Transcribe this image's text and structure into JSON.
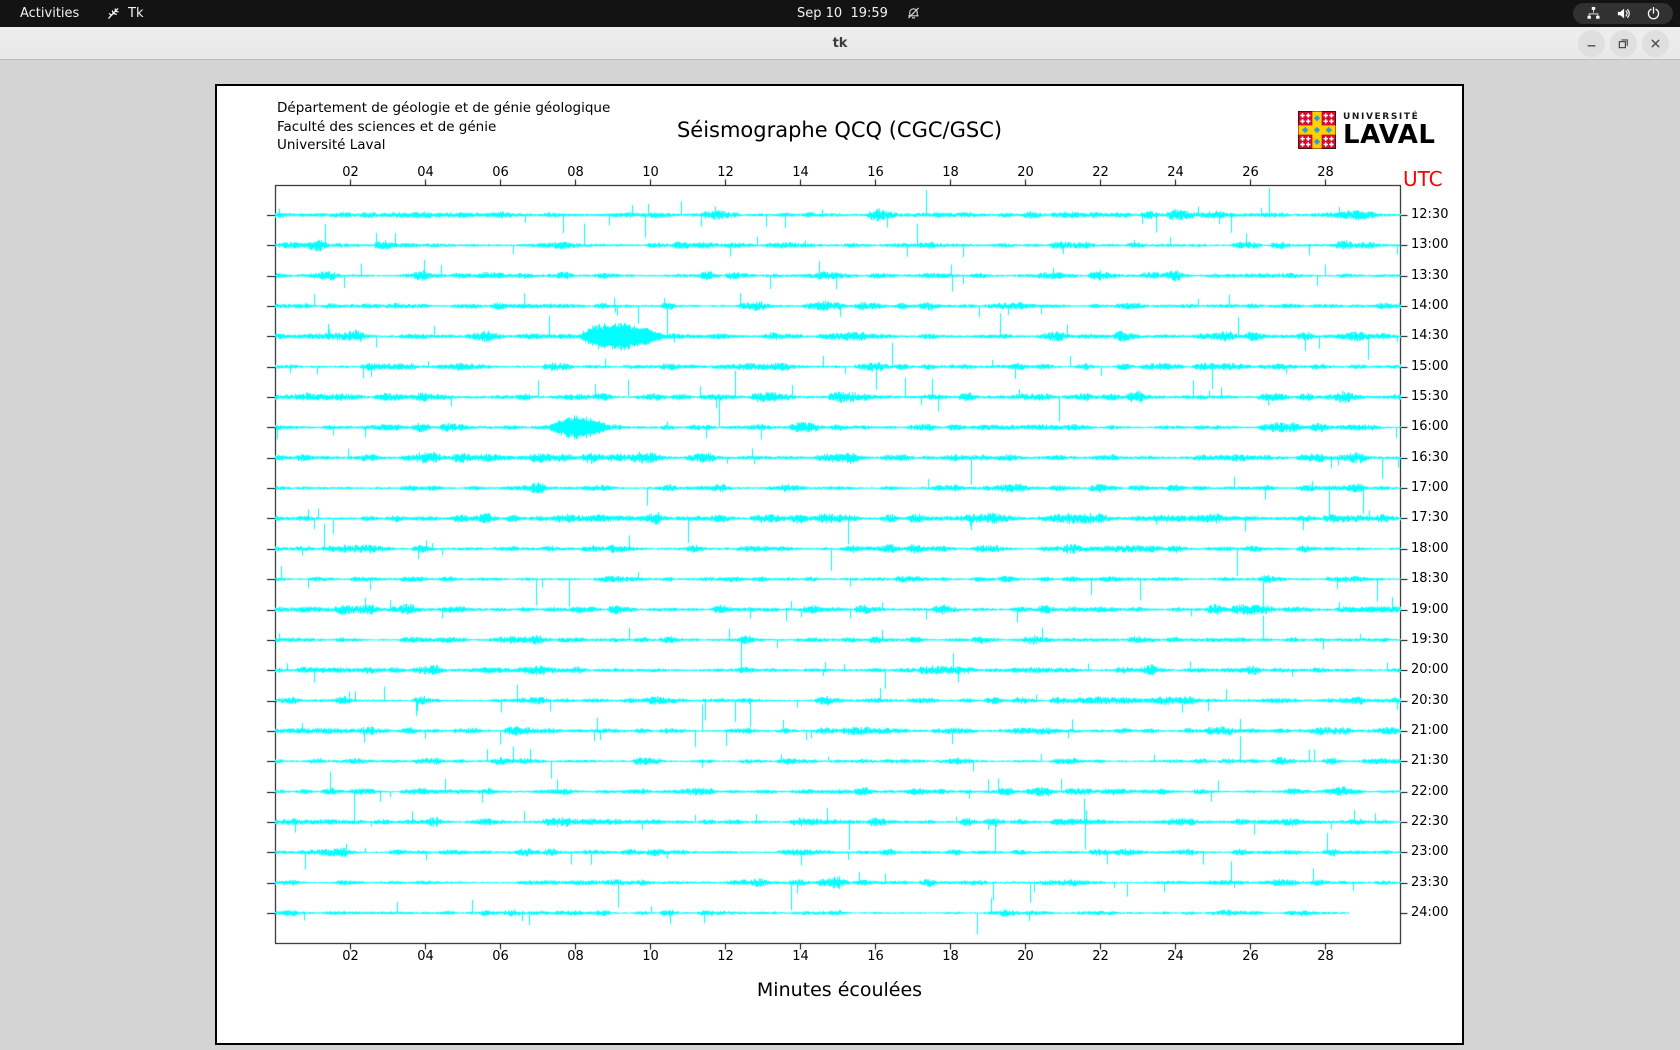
{
  "desktop": {
    "top_bar": {
      "activities_label": "Activities",
      "app_name": "Tk",
      "clock": "Sep 10  19:59"
    },
    "window": {
      "title": "tk"
    }
  },
  "plot": {
    "header_lines": [
      "Département de géologie et de génie géologique",
      "Faculté des sciences et de génie",
      "Université Laval"
    ],
    "logo_line1": "UNIVERSITÉ",
    "logo_line2": "LAVAL"
  },
  "chart_data": {
    "type": "seismogram-helicorder",
    "title": "Séismographe QCQ (CGC/GSC)",
    "xlabel": "Minutes écoulées",
    "right_axis_label": "UTC",
    "x_ticks": [
      "02",
      "04",
      "06",
      "08",
      "10",
      "12",
      "14",
      "16",
      "18",
      "20",
      "22",
      "24",
      "26",
      "28"
    ],
    "x_range_minutes": [
      0,
      30
    ],
    "trace_color": "#00ffff",
    "axis_color": "#000000",
    "utc_label_color": "#ff0000",
    "rows": [
      {
        "label": "12:30",
        "activity": 0.8,
        "end_minute": 30,
        "bursts": []
      },
      {
        "label": "13:00",
        "activity": 0.65,
        "end_minute": 30,
        "bursts": []
      },
      {
        "label": "13:30",
        "activity": 0.6,
        "end_minute": 30,
        "bursts": []
      },
      {
        "label": "14:00",
        "activity": 0.5,
        "end_minute": 30,
        "bursts": []
      },
      {
        "label": "14:30",
        "activity": 0.75,
        "end_minute": 30,
        "bursts": [
          {
            "start": 8.1,
            "end": 10.4,
            "amp": 12
          }
        ]
      },
      {
        "label": "15:00",
        "activity": 0.5,
        "end_minute": 30,
        "bursts": []
      },
      {
        "label": "15:30",
        "activity": 0.75,
        "end_minute": 30,
        "bursts": []
      },
      {
        "label": "16:00",
        "activity": 0.55,
        "end_minute": 30,
        "bursts": [
          {
            "start": 7.3,
            "end": 8.9,
            "amp": 11
          }
        ]
      },
      {
        "label": "16:30",
        "activity": 0.85,
        "end_minute": 30,
        "bursts": []
      },
      {
        "label": "17:00",
        "activity": 0.5,
        "end_minute": 30,
        "bursts": []
      },
      {
        "label": "17:30",
        "activity": 0.8,
        "end_minute": 30,
        "bursts": []
      },
      {
        "label": "18:00",
        "activity": 0.6,
        "end_minute": 30,
        "bursts": []
      },
      {
        "label": "18:30",
        "activity": 0.45,
        "end_minute": 30,
        "bursts": []
      },
      {
        "label": "19:00",
        "activity": 0.65,
        "end_minute": 30,
        "bursts": []
      },
      {
        "label": "19:30",
        "activity": 0.5,
        "end_minute": 30,
        "bursts": []
      },
      {
        "label": "20:00",
        "activity": 0.6,
        "end_minute": 30,
        "bursts": []
      },
      {
        "label": "20:30",
        "activity": 0.5,
        "end_minute": 30,
        "bursts": []
      },
      {
        "label": "21:00",
        "activity": 0.6,
        "end_minute": 30,
        "bursts": []
      },
      {
        "label": "21:30",
        "activity": 0.4,
        "end_minute": 30,
        "bursts": []
      },
      {
        "label": "22:00",
        "activity": 0.45,
        "end_minute": 30,
        "bursts": []
      },
      {
        "label": "22:30",
        "activity": 0.65,
        "end_minute": 30,
        "bursts": []
      },
      {
        "label": "23:00",
        "activity": 0.4,
        "end_minute": 30,
        "bursts": []
      },
      {
        "label": "23:30",
        "activity": 0.45,
        "end_minute": 30,
        "bursts": []
      },
      {
        "label": "24:00",
        "activity": 0.35,
        "end_minute": 28.6,
        "bursts": []
      }
    ]
  }
}
